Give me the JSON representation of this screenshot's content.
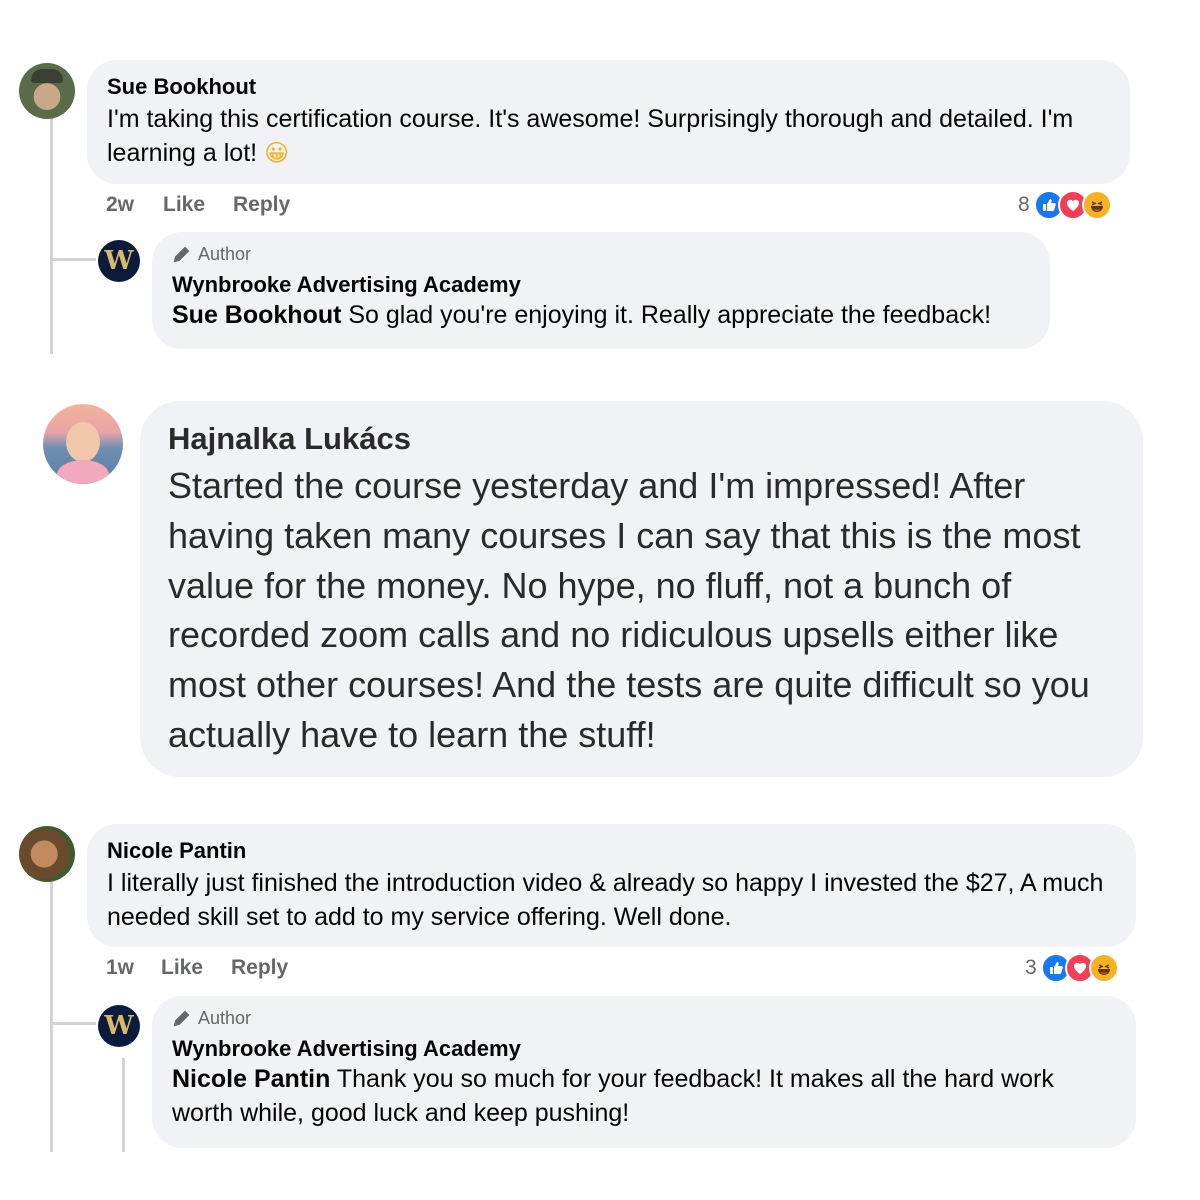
{
  "colors": {
    "bubble": "#f0f2f5",
    "muted": "#65676b",
    "like": "#1877f2",
    "love": "#f33e58",
    "haha": "#f7b125"
  },
  "comments": [
    {
      "author": "Sue Bookhout",
      "text": "I'm taking this certification course. It's awesome! Surprisingly thorough and detailed. I'm learning a lot!",
      "emoji": "😀",
      "time": "2w",
      "like_label": "Like",
      "reply_label": "Reply",
      "reaction_count": "8",
      "reactions": [
        "like-icon",
        "love-icon",
        "haha-icon"
      ],
      "reply": {
        "badge": "Author",
        "badge_icon": "pencil-icon",
        "author": "Wynbrooke Advertising Academy",
        "mention": "Sue Bookhout",
        "text": " So glad you're enjoying it. Really appreciate the feedback!"
      }
    },
    {
      "author": "Hajnalka Lukács",
      "text": "Started the course yesterday and I'm impressed! After having taken many courses I can say that this is the most value for the money. No hype, no fluff, not a bunch of recorded zoom calls and no ridiculous upsells either like most other courses! And the tests are quite difficult so you actually have to learn the stuff!"
    },
    {
      "author": "Nicole Pantin",
      "text": "I literally just finished the introduction video & already so happy I invested the $27, A much needed skill set to add to my service offering. Well done.",
      "time": "1w",
      "like_label": "Like",
      "reply_label": "Reply",
      "reaction_count": "3",
      "reactions": [
        "like-icon",
        "love-icon",
        "haha-icon"
      ],
      "reply": {
        "badge": "Author",
        "badge_icon": "pencil-icon",
        "author": "Wynbrooke Advertising Academy",
        "mention": "Nicole Pantin",
        "text": " Thank you so much for your feedback! It makes all the hard work worth while, good luck and keep pushing!"
      }
    }
  ],
  "logo_letter": "W"
}
